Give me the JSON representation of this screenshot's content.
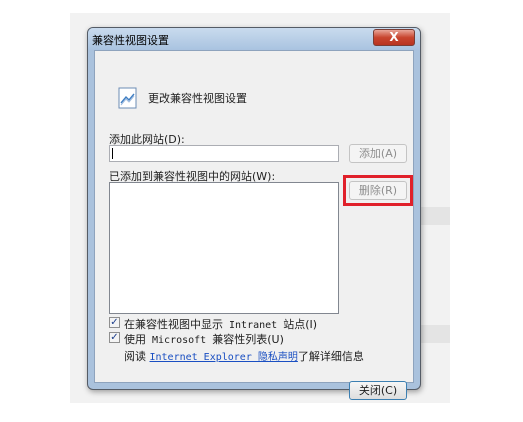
{
  "window": {
    "title": "兼容性视图设置",
    "close_glyph": "X"
  },
  "header": {
    "text": "更改兼容性视图设置",
    "icon": "document-compat-icon"
  },
  "add_site": {
    "label": "添加此网站(D):",
    "input_value": "",
    "add_button_label": "添加(A)",
    "add_button_enabled": false
  },
  "site_list": {
    "label": "已添加到兼容性视图中的网站(W):",
    "items": [],
    "remove_button_label": "删除(R)",
    "remove_button_enabled": false,
    "remove_button_highlighted": true,
    "highlight_color": "#e0202a"
  },
  "options": {
    "show_intranet": {
      "label": "在兼容性视图中显示",
      "mono": " Intranet ",
      "label_tail": "站点(I)",
      "checked": true
    },
    "use_ms_list": {
      "label": "使用",
      "mono": " Microsoft ",
      "label_tail": "兼容性列表(U)",
      "checked": true
    }
  },
  "privacy": {
    "prefix": "阅读",
    "link_text": "Internet Explorer 隐私声明",
    "suffix": "了解详细信息"
  },
  "footer": {
    "close_button_label": "关闭(C)"
  }
}
